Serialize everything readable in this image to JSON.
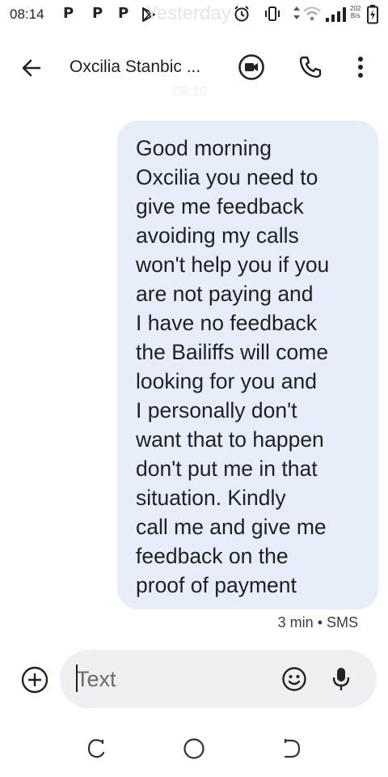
{
  "status_bar": {
    "time": "08:14",
    "notification_letters": [
      "P",
      "P",
      "P"
    ],
    "faded_text": "Yesterday",
    "net_speed_value": "202",
    "net_speed_unit": "B/s",
    "icons": [
      "play-store-icon",
      "alarm-icon",
      "vibrate-icon",
      "data-arrows-icon",
      "wifi-icon",
      "signal-icon",
      "battery-icon"
    ]
  },
  "toolbar": {
    "contact_name": "Oxcilia Stanbic ...",
    "date_ghost": "08:10",
    "icons": [
      "back-arrow-icon",
      "video-call-icon",
      "phone-icon",
      "more-vert-icon"
    ]
  },
  "message": {
    "text": "Good morning\nOxcilia you need to\ngive me feedback\navoiding my calls\nwon't help you if you\nare not paying and\nI have no feedback\nthe Bailiffs will come\nlooking for you and\nI personally don't\nwant that to happen\ndon't put me in that\nsituation. Kindly\ncall me and give me\nfeedback on the\nproof of payment",
    "meta": "3 min • SMS",
    "bubble_color": "#e8eef9"
  },
  "compose": {
    "placeholder": "Text",
    "icons": [
      "add-circle-icon",
      "emoji-icon",
      "microphone-icon"
    ],
    "field_color": "#eef0f4"
  },
  "nav_bar": {
    "icons": [
      "recent-apps-icon",
      "home-icon",
      "back-icon"
    ]
  }
}
